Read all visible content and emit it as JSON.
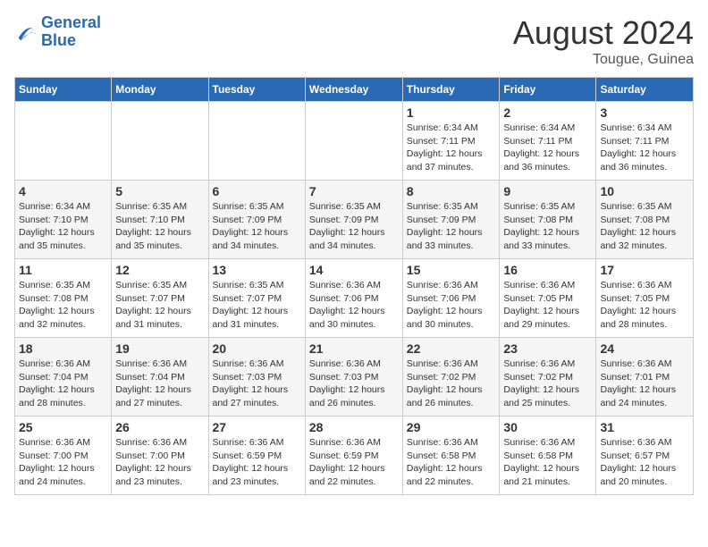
{
  "header": {
    "logo_line1": "General",
    "logo_line2": "Blue",
    "month_year": "August 2024",
    "location": "Tougue, Guinea"
  },
  "weekdays": [
    "Sunday",
    "Monday",
    "Tuesday",
    "Wednesday",
    "Thursday",
    "Friday",
    "Saturday"
  ],
  "weeks": [
    [
      {
        "day": "",
        "info": ""
      },
      {
        "day": "",
        "info": ""
      },
      {
        "day": "",
        "info": ""
      },
      {
        "day": "",
        "info": ""
      },
      {
        "day": "1",
        "info": "Sunrise: 6:34 AM\nSunset: 7:11 PM\nDaylight: 12 hours\nand 37 minutes."
      },
      {
        "day": "2",
        "info": "Sunrise: 6:34 AM\nSunset: 7:11 PM\nDaylight: 12 hours\nand 36 minutes."
      },
      {
        "day": "3",
        "info": "Sunrise: 6:34 AM\nSunset: 7:11 PM\nDaylight: 12 hours\nand 36 minutes."
      }
    ],
    [
      {
        "day": "4",
        "info": "Sunrise: 6:34 AM\nSunset: 7:10 PM\nDaylight: 12 hours\nand 35 minutes."
      },
      {
        "day": "5",
        "info": "Sunrise: 6:35 AM\nSunset: 7:10 PM\nDaylight: 12 hours\nand 35 minutes."
      },
      {
        "day": "6",
        "info": "Sunrise: 6:35 AM\nSunset: 7:09 PM\nDaylight: 12 hours\nand 34 minutes."
      },
      {
        "day": "7",
        "info": "Sunrise: 6:35 AM\nSunset: 7:09 PM\nDaylight: 12 hours\nand 34 minutes."
      },
      {
        "day": "8",
        "info": "Sunrise: 6:35 AM\nSunset: 7:09 PM\nDaylight: 12 hours\nand 33 minutes."
      },
      {
        "day": "9",
        "info": "Sunrise: 6:35 AM\nSunset: 7:08 PM\nDaylight: 12 hours\nand 33 minutes."
      },
      {
        "day": "10",
        "info": "Sunrise: 6:35 AM\nSunset: 7:08 PM\nDaylight: 12 hours\nand 32 minutes."
      }
    ],
    [
      {
        "day": "11",
        "info": "Sunrise: 6:35 AM\nSunset: 7:08 PM\nDaylight: 12 hours\nand 32 minutes."
      },
      {
        "day": "12",
        "info": "Sunrise: 6:35 AM\nSunset: 7:07 PM\nDaylight: 12 hours\nand 31 minutes."
      },
      {
        "day": "13",
        "info": "Sunrise: 6:35 AM\nSunset: 7:07 PM\nDaylight: 12 hours\nand 31 minutes."
      },
      {
        "day": "14",
        "info": "Sunrise: 6:36 AM\nSunset: 7:06 PM\nDaylight: 12 hours\nand 30 minutes."
      },
      {
        "day": "15",
        "info": "Sunrise: 6:36 AM\nSunset: 7:06 PM\nDaylight: 12 hours\nand 30 minutes."
      },
      {
        "day": "16",
        "info": "Sunrise: 6:36 AM\nSunset: 7:05 PM\nDaylight: 12 hours\nand 29 minutes."
      },
      {
        "day": "17",
        "info": "Sunrise: 6:36 AM\nSunset: 7:05 PM\nDaylight: 12 hours\nand 28 minutes."
      }
    ],
    [
      {
        "day": "18",
        "info": "Sunrise: 6:36 AM\nSunset: 7:04 PM\nDaylight: 12 hours\nand 28 minutes."
      },
      {
        "day": "19",
        "info": "Sunrise: 6:36 AM\nSunset: 7:04 PM\nDaylight: 12 hours\nand 27 minutes."
      },
      {
        "day": "20",
        "info": "Sunrise: 6:36 AM\nSunset: 7:03 PM\nDaylight: 12 hours\nand 27 minutes."
      },
      {
        "day": "21",
        "info": "Sunrise: 6:36 AM\nSunset: 7:03 PM\nDaylight: 12 hours\nand 26 minutes."
      },
      {
        "day": "22",
        "info": "Sunrise: 6:36 AM\nSunset: 7:02 PM\nDaylight: 12 hours\nand 26 minutes."
      },
      {
        "day": "23",
        "info": "Sunrise: 6:36 AM\nSunset: 7:02 PM\nDaylight: 12 hours\nand 25 minutes."
      },
      {
        "day": "24",
        "info": "Sunrise: 6:36 AM\nSunset: 7:01 PM\nDaylight: 12 hours\nand 24 minutes."
      }
    ],
    [
      {
        "day": "25",
        "info": "Sunrise: 6:36 AM\nSunset: 7:00 PM\nDaylight: 12 hours\nand 24 minutes."
      },
      {
        "day": "26",
        "info": "Sunrise: 6:36 AM\nSunset: 7:00 PM\nDaylight: 12 hours\nand 23 minutes."
      },
      {
        "day": "27",
        "info": "Sunrise: 6:36 AM\nSunset: 6:59 PM\nDaylight: 12 hours\nand 23 minutes."
      },
      {
        "day": "28",
        "info": "Sunrise: 6:36 AM\nSunset: 6:59 PM\nDaylight: 12 hours\nand 22 minutes."
      },
      {
        "day": "29",
        "info": "Sunrise: 6:36 AM\nSunset: 6:58 PM\nDaylight: 12 hours\nand 22 minutes."
      },
      {
        "day": "30",
        "info": "Sunrise: 6:36 AM\nSunset: 6:58 PM\nDaylight: 12 hours\nand 21 minutes."
      },
      {
        "day": "31",
        "info": "Sunrise: 6:36 AM\nSunset: 6:57 PM\nDaylight: 12 hours\nand 20 minutes."
      }
    ]
  ]
}
